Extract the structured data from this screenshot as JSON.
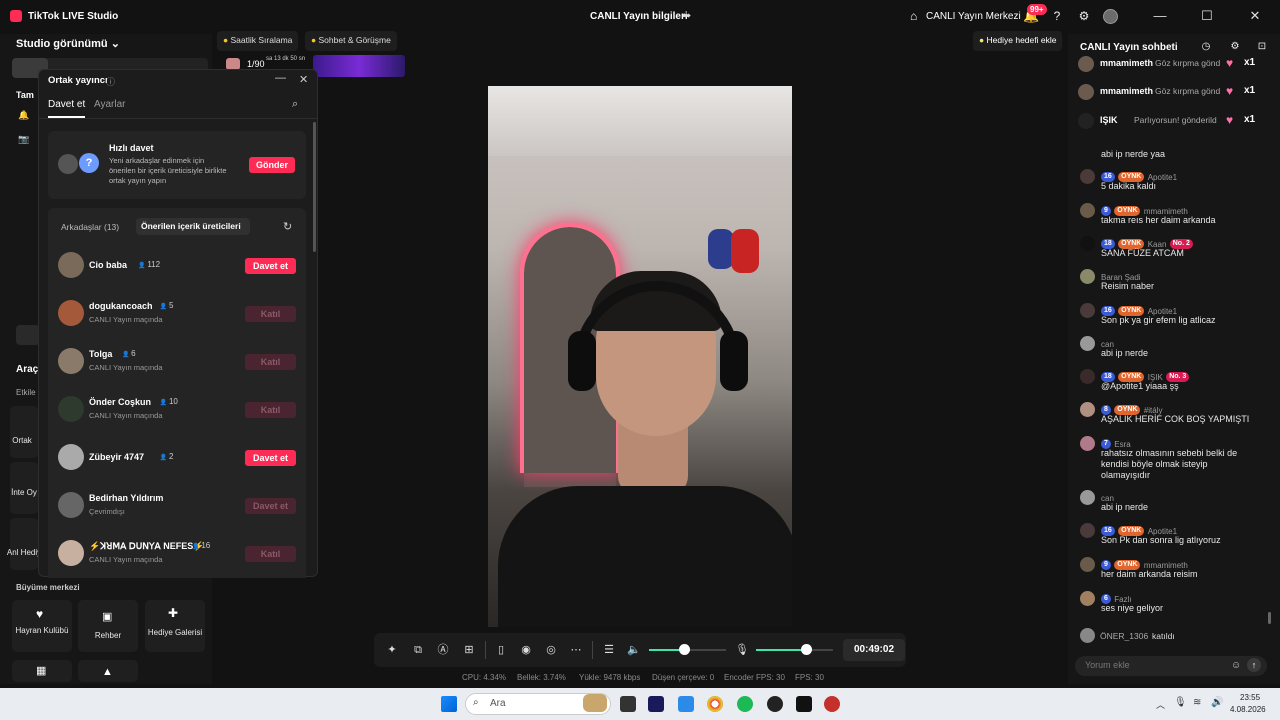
{
  "app": {
    "title": "TikTok LIVE Studio",
    "center_title": "CANLI Yayın bilgileri",
    "live_center": "CANLI Yayın Merkezi",
    "notif_badge": "99+"
  },
  "left": {
    "studio_view": "Studio görünümü",
    "section_tam": "Tam",
    "section_arac": "Araç",
    "section_etkil": "Etkile",
    "tile_ortak": "Ortak",
    "tile_inte": "İnte Oy",
    "tile_anli": "Anl Hediy",
    "growth_title": "Büyüme merkezi",
    "growth_tiles": [
      "Hayran Kulübü",
      "Rehber",
      "Hediye Galerisi"
    ]
  },
  "top_tabs": [
    "Saatlik Sıralama",
    "Sohbet & Görüşme"
  ],
  "gift_goal": "Hediye hedefi ekle",
  "rank_counter": "1/90",
  "rank_time": "sa 13 dk 50 sn",
  "modal": {
    "title": "Ortak yayıncı",
    "tab_invite": "Davet et",
    "tab_settings": "Ayarlar",
    "quick_title": "Hızlı davet",
    "quick_desc": "Yeni arkadaşlar edinmek için önerilen bir içerik üreticisiyle birlikte ortak yayın yapın",
    "quick_btn": "Gönder",
    "tab_friends": "Arkadaşlar (13)",
    "tab_suggested": "Önerilen içerik üreticileri",
    "rows": [
      {
        "name": "Cio baba",
        "count": "112",
        "sub": "",
        "btn": "Davet et",
        "active": true
      },
      {
        "name": "dogukancoach",
        "count": "5",
        "sub": "CANLI Yayın maçında",
        "btn": "Katıl",
        "active": false
      },
      {
        "name": "Tolga",
        "count": "6",
        "sub": "CANLI Yayın maçında",
        "btn": "Katıl",
        "active": false
      },
      {
        "name": "Önder Coşkun",
        "count": "10",
        "sub": "CANLI Yayın maçında",
        "btn": "Katıl",
        "active": false
      },
      {
        "name": "Zübeyir 4747",
        "count": "2",
        "sub": "",
        "btn": "Davet et",
        "active": true
      },
      {
        "name": "Bedirhan Yıldırım",
        "count": "",
        "sub": "Çevrimdışı",
        "btn": "Davet et",
        "active": false
      },
      {
        "name": "⚡ꓘꓤꓟꓮ ꓓꓴꓠꓬꓮ NEFES⚡",
        "count": "16",
        "sub": "CANLI Yayın maçında",
        "btn": "Katıl",
        "active": false
      }
    ]
  },
  "controls": {
    "timer": "00:49:02",
    "volume": 0.45,
    "mic": 0.65
  },
  "stats": {
    "cpu": "CPU: 4.34%",
    "mem": "Bellek: 3.74%",
    "upload": "Yükle: 9478 kbps",
    "dropped": "Düşen çerçeve: 0",
    "enc": "Encoder FPS: 30",
    "fps": "FPS: 30"
  },
  "chat": {
    "title": "CANLI Yayın sohbeti",
    "pinned": [
      {
        "user": "mmamimeth",
        "text": "Göz kırpma gönd",
        "mult": "x1"
      },
      {
        "user": "mmamimeth",
        "text": "Göz kırpma gönd",
        "mult": "x1"
      },
      {
        "user": "IŞIK",
        "text": "Parlıyorsun! gönderild",
        "mult": "x1"
      }
    ],
    "messages": [
      {
        "lvl": "",
        "oynk": "",
        "rank": "",
        "user": "",
        "text": "abi ip nerde yaa"
      },
      {
        "lvl": "16",
        "oynk": "OYNK",
        "rank": "",
        "user": "Apotite1",
        "text": "5 dakika kaldı"
      },
      {
        "lvl": "9",
        "oynk": "OYNK",
        "rank": "",
        "user": "mmamimeth",
        "text": "takma reıs her daim arkanda"
      },
      {
        "lvl": "18",
        "oynk": "OYNK",
        "rank": "No. 2",
        "user": "Kaan",
        "text": "SANA FÜZE ATCAM"
      },
      {
        "lvl": "",
        "oynk": "",
        "rank": "",
        "user": "Baran Şadi",
        "text": "Reisim naber"
      },
      {
        "lvl": "16",
        "oynk": "OYNK",
        "rank": "",
        "user": "Apotite1",
        "text": "Son pk ya gir efem lig atlicaz"
      },
      {
        "lvl": "",
        "oynk": "",
        "rank": "",
        "user": "can",
        "text": "abi ip nerde"
      },
      {
        "lvl": "18",
        "oynk": "OYNK",
        "rank": "No. 3",
        "user": "IŞIK",
        "text": "@Apotite1 yiaaa şş"
      },
      {
        "lvl": "8",
        "oynk": "OYNK",
        "rank": "",
        "user": "#itály",
        "text": "AŞALIK HERİF COK BOŞ YAPMIŞTI"
      },
      {
        "lvl": "7",
        "oynk": "",
        "rank": "",
        "user": "Esra",
        "text": "rahatsız olmasının sebebi belki de kendisi böyle olmak isteyip olamayışıdır"
      },
      {
        "lvl": "",
        "oynk": "",
        "rank": "",
        "user": "can",
        "text": "abi ip nerde"
      },
      {
        "lvl": "16",
        "oynk": "OYNK",
        "rank": "",
        "user": "Apotite1",
        "text": "Son Pk dan sonra lig atlıyoruz"
      },
      {
        "lvl": "9",
        "oynk": "OYNK",
        "rank": "",
        "user": "mmamimeth",
        "text": "her daim arkanda reisim"
      },
      {
        "lvl": "6",
        "oynk": "",
        "rank": "",
        "user": "Fazlı",
        "text": "ses niye geliyor"
      }
    ],
    "joined_user": "ÖNER_1306",
    "joined_text": "katıldı",
    "comment_placeholder": "Yorum ekle"
  },
  "taskbar": {
    "search": "Ara",
    "time": "23:55",
    "date": "4.08.2026"
  }
}
